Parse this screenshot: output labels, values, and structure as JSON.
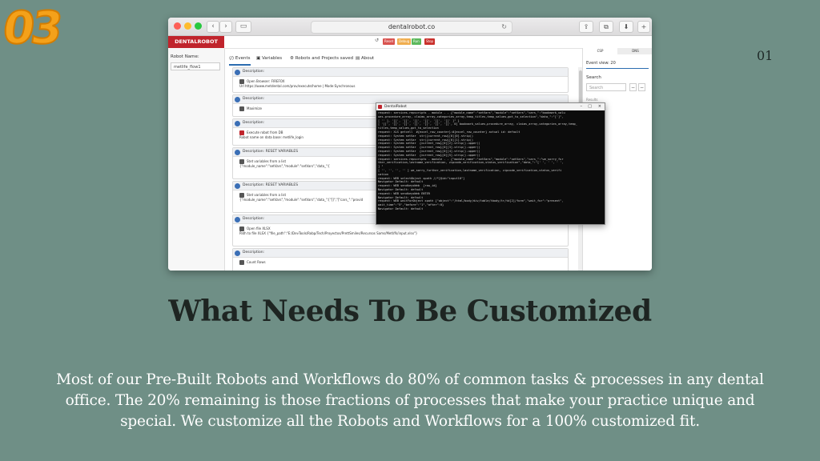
{
  "badge": "03",
  "page_number": "01",
  "heading": "What Needs To Be Customized",
  "body": "Most of our Pre-Built Robots and Workflows do 80% of common tasks & processes in any dental office. The 20% remaining is those fractions of processes that make your practice unique and special. We customize all the Robots and Workflows for a 100% customized fit.",
  "browser": {
    "url": "dentalrobot.co",
    "back": "‹",
    "forward": "›",
    "share": "⇪",
    "tabs": "⧉",
    "download": "⬇",
    "new_tab": "+"
  },
  "app": {
    "logo": "DENTALROBOT",
    "toolbar": {
      "btn1": "Reset",
      "btn2": "Debug",
      "btn3": "Run",
      "btn4": "Stop"
    },
    "robot_name_label": "Robot Name:",
    "robot_name_value": "metlife_flow1",
    "tabs": {
      "events": "Events",
      "variables": "Variables",
      "robots": "Robots and Projects saved",
      "about": "About"
    },
    "cards": [
      {
        "head": "Description:",
        "l1": "Open Browser: FIREFOX",
        "l2": "Url https://www.metdental.com/prov/execute/home | Mode:Synchronous"
      },
      {
        "head": "Description:",
        "l1": "Maximize",
        "l2": ""
      },
      {
        "head": "Description:",
        "l1": "Execute robot from DB",
        "l2": "Robot name on data base: metlife_login"
      },
      {
        "head": "Description: RESET VARIABLES",
        "l1": "Stet variables from a list",
        "l2": "{\"module_name\":\"setVars\",\"module\":\"setVars\",\"data_\":["
      },
      {
        "head": "Description: RESET VARIABLES",
        "l1": "Stet variables from a list",
        "l2": "{\"module_name\":\"setVars\",\"module\":\"setVars\",\"data_\":[\"[]\",\"[\"cars_\":\"provid"
      },
      {
        "head": "Description:",
        "l1": "Open file XLSX",
        "l2": "Path to file XLSX {\"file_path\":\"E:/DevTools/Robp/Tech/Proyectos/PrettSmiles/Recursos Sams/Metl/fk/input.xlsx\"}"
      },
      {
        "head": "Description:",
        "l1": "Count Rows",
        "l2": ""
      }
    ],
    "right_panel": {
      "tab1": "CSP",
      "tab2": "DNS",
      "event_view": "Event view: 20",
      "search_label": "Search",
      "search_placeholder": "Search",
      "results": "Results"
    },
    "console": {
      "title": "DentalRobot",
      "lines": [
        "request: services.repscripts - module - - {\"module_name\":\"setVars\",\"module\":\"setVars\",\"cars_\":\"bookmark_valu",
        "ues.procedure_array, claims_array,categories_array,temp_titles,temp_values,got_to_selection\",\"data_\":\"[']\",",
        "[ '' ], '[]', '[]', '[]', '[]', '[]', '[]' ]\" }",
        "[ '[]', '[]', '[]', '[]', '[]', '[]', '[]', 0] bookmark_values,procedure_array, claims_array,categories_array,temp_",
        "titles,temp_values,got_to_selection",
        "request: XLS getcell  #{excel_row_counter}:#{excel_row_counter} actual id: default",
        "request: System setVar  str({current_row}[0][0].strip()",
        "request: System setVar  str({current_row}[0][1].strip()",
        "request: System setVar  {current_row}[0][2].strip().upper()",
        "request: System setVar  {current_row}[0][3].strip().upper()",
        "request: System setVar  {current_row}[0][4].strip().upper()",
        "request: System setVar  {current_row}[0][5].strip().upper()",
        "request: services.repscripts - module - - {\"module_name\":\"setVars\",\"module\":\"setVars\",\"cars_\":\"we_sorry_fur",
        "ther_verification,lastname_verification, zipcode_verification,status_verification\",\"data_\":\"[' ', ' ', ' ',",
        "] \"",
        "[ '', '', '', '' ] we_sorry_further_verification,lastname_verification, zipcode_verification,status_verifi",
        "cation",
        "request: WEB selectObject xpath //*[@id=\"input10\"]",
        "Navigator Default: default",
        "request: WEB sendkeysWeb  {row_id}",
        "Navigator Default: default",
        "request: WEB sendkeysWeb ENTER",
        "Navigator Default: default",
        "request: WEB waitForObject xpath {\"object\":\"/html/body/div/table/tbody/tr/td[2]/form\",\"wait_for\":\"present\",",
        "wait_time\":\"5\",\"before\":\"1\",\"after\":0}",
        "Navigator Default: default"
      ]
    }
  }
}
